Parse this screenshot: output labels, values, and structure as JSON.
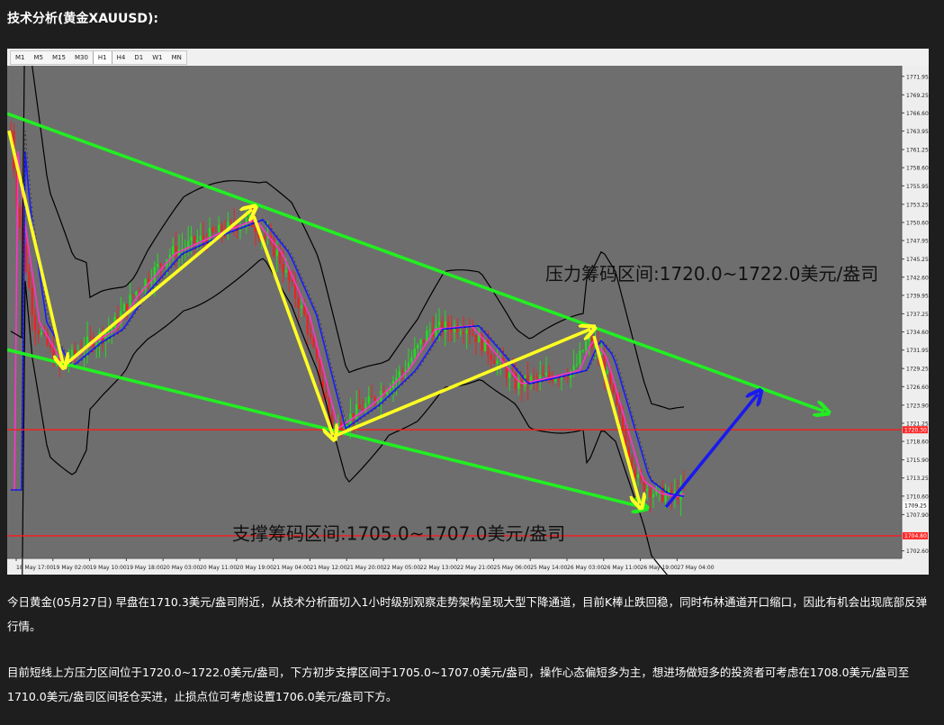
{
  "heading": "技术分析(黄金XAUUSD):",
  "timeframes": [
    "M1",
    "M5",
    "M15",
    "M30",
    "H1",
    "H4",
    "D1",
    "W1",
    "MN"
  ],
  "active_timeframe": "H1",
  "chart_data": {
    "type": "candlestick",
    "instrument": "黄金XAUUSD",
    "timeframe": "H1",
    "price_axis": {
      "ticks": [
        "1771.95",
        "1769.25",
        "1766.60",
        "1763.95",
        "1761.25",
        "1758.60",
        "1755.95",
        "1753.25",
        "1750.60",
        "1747.95",
        "1745.25",
        "1742.60",
        "1739.95",
        "1737.25",
        "1734.60",
        "1731.95",
        "1729.25",
        "1726.60",
        "1723.90",
        "1721.25",
        "1718.60",
        "1715.90",
        "1713.25",
        "1710.60",
        "1707.90",
        "1702.60"
      ],
      "ylim": [
        1701.5,
        1773.5
      ]
    },
    "time_axis": {
      "ticks": [
        "18 May 17:00",
        "19 May 02:00",
        "19 May 10:00",
        "19 May 18:00",
        "20 May 03:00",
        "20 May 11:00",
        "20 May 19:00",
        "21 May 04:00",
        "21 May 12:00",
        "21 May 20:00",
        "22 May 05:00",
        "22 May 13:00",
        "22 May 21:00",
        "25 May 06:00",
        "25 May 14:00",
        "26 May 03:00",
        "26 May 11:00",
        "26 May 19:00",
        "27 May 04:00"
      ]
    },
    "price_tags": [
      {
        "value": "1720.30",
        "color": "#ff2a2a"
      },
      {
        "value": "1709.25",
        "color": "#ffffff"
      },
      {
        "value": "1704.80",
        "color": "#ff2a2a"
      }
    ],
    "horizontal_levels": [
      1720.3,
      1704.8
    ],
    "annotations": {
      "resistance": "压力筹码区间:1720.0~1722.0美元/盎司",
      "support": "支撑筹码区间:1705.0~1707.0美元/盎司"
    },
    "colors": {
      "background": "#6e6e6e",
      "bull_candle": "#22dd22",
      "bear_candle": "#ee2222",
      "bollinger": "#000000",
      "ma_fast": "#ff33cc",
      "ma_slow": "#1a1aff",
      "channel": "#22ee22",
      "swing_arrows": "#ffff22",
      "projection_arrow": "#1a1aee",
      "level_line": "#ff1a1a"
    }
  },
  "paragraphs": [
    "今日黄金(05月27日) 早盘在1710.3美元/盎司附近，从技术分析面切入1小时级别观察走势架构呈现大型下降通道，目前K棒止跌回稳，同时布林通道开口缩口，因此有机会出现底部反弹行情。",
    "目前短线上方压力区间位于1720.0~1722.0美元/盎司，下方初步支撑区间于1705.0~1707.0美元/盎司，操作心态偏短多为主，想进场做短多的投资者可考虑在1708.0美元/盎司至1710.0美元/盎司区间轻仓买进，止损点位可考虑设置1706.0美元/盎司下方。"
  ]
}
